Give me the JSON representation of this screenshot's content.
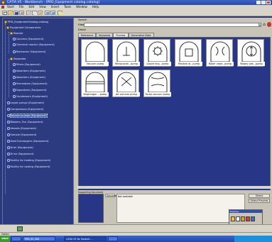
{
  "window": {
    "title": "CATIA V5 - Workbench - [PRD_Equipment catalog.catalog]",
    "menu": [
      "Start",
      "File",
      "Edit",
      "View",
      "Insert",
      "Tools",
      "Window",
      "Help"
    ]
  },
  "tree": {
    "items": [
      {
        "label": "PRD_EquipmentCatalog.catalog"
      },
      {
        "label": "Equipment Components"
      },
      {
        "label": "Reactor"
      },
      {
        "label": "Columns (Equipment)"
      },
      {
        "label": "Chemical reactor (Equipment)"
      },
      {
        "label": "Bioreactor (Equipment)"
      },
      {
        "label": "Separator"
      },
      {
        "label": "Filters (Equipment)"
      },
      {
        "label": "Adsorbers (Equipment)"
      },
      {
        "label": "Absorbers (Equipment)"
      },
      {
        "label": "Permeators (Equipment)"
      },
      {
        "label": "Separators (Equipment)"
      },
      {
        "label": "Condensers (Equipment)"
      },
      {
        "label": "Liquid pumps (Equipment)"
      },
      {
        "label": "Compressors (Equipment)"
      },
      {
        "label": "Vacuum pumps (Equipment)"
      },
      {
        "label": "Blowers, Fan (Equipment)"
      },
      {
        "label": "Vessels (Equipment)"
      },
      {
        "label": "Sample (Equipment)"
      },
      {
        "label": "Heat Exchangers (Equipment)"
      },
      {
        "label": "Drier (Equipment)"
      },
      {
        "label": "Drive (Equipment)"
      },
      {
        "label": "Facility for heating (Equipment)"
      },
      {
        "label": "Facility for cooling (Equipment)"
      }
    ]
  },
  "search": {
    "search_label": "Search",
    "filter_label": "Filter",
    "filter_value": "",
    "detail_label": "Detail"
  },
  "tabs": [
    "Reference",
    "Keywords",
    "Preview",
    "Generative Data"
  ],
  "thumbnails": [
    {
      "caption": "Vacuum pump"
    },
    {
      "caption": "Reciprocati...pump"
    },
    {
      "caption": "Liquid ring...pump"
    },
    {
      "caption": "Positive di...pump"
    },
    {
      "caption": "Roller vane...pump"
    },
    {
      "caption": "Rotary pist...pump"
    },
    {
      "caption": "Diaphragm ...pump"
    },
    {
      "caption": "Jet vacuum pump"
    },
    {
      "caption": "Turbo vacuum pump"
    }
  ],
  "lower": {
    "supporting_label": "Supporting Document",
    "document_label": "Document",
    "not_available": "Not available",
    "select_button": "Select",
    "select_preview_button": "Select Preview"
  },
  "explorer": {
    "title": "Explorer"
  },
  "status": {
    "text": "Option"
  },
  "taskbar": {
    "start": "start",
    "items": [
      "",
      "PRD_00_006",
      "CATIA V5 for Student ...",
      ""
    ],
    "clock": ""
  },
  "colors": {
    "accent": "#3060e0",
    "pane_bg": "#2c3a80"
  }
}
